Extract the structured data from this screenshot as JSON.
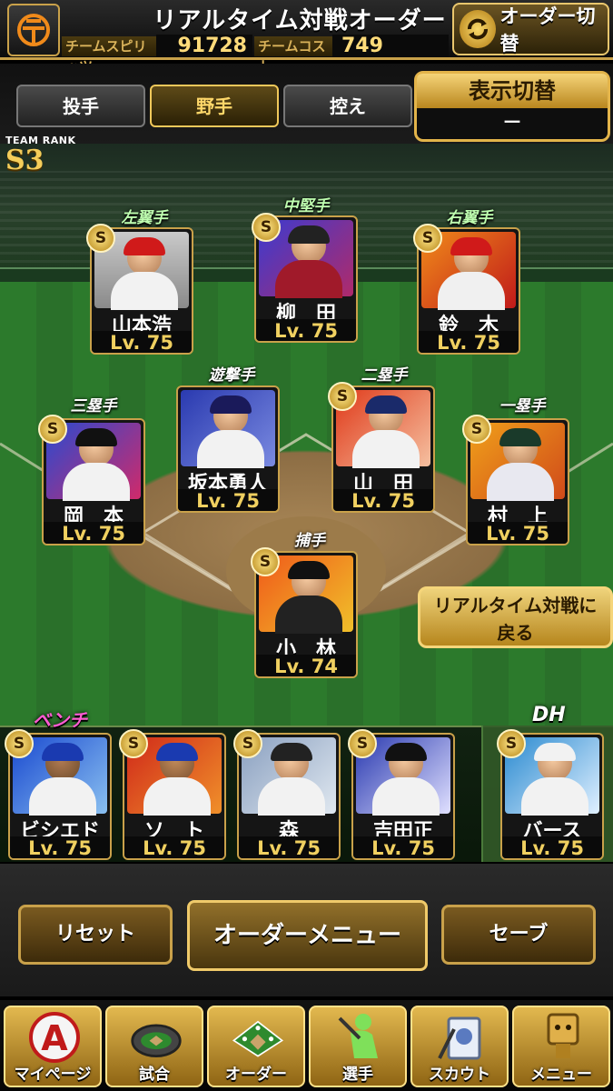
{
  "header": {
    "title": "リアルタイム対戦オーダー",
    "spirit_label": "チームスピリッツ",
    "spirit_value": "91728",
    "cost_label": "チームコスト",
    "cost_value": "749",
    "order_switch_label": "オーダー切替"
  },
  "tabs": [
    {
      "label": "投手",
      "active": false
    },
    {
      "label": "野手",
      "active": true
    },
    {
      "label": "控え",
      "active": false
    }
  ],
  "display_switch": {
    "label": "表示切替",
    "value": "－"
  },
  "team_rank": {
    "label": "TEAM RANK",
    "value": "S3"
  },
  "positions": {
    "lf": "左翼手",
    "cf": "中堅手",
    "rf": "右翼手",
    "ss": "遊撃手",
    "second": "二塁手",
    "third": "三塁手",
    "first": "一塁手",
    "catcher": "捕手",
    "bench": "ベンチ",
    "dh": "DH"
  },
  "players": {
    "lf": {
      "name": "山本浩",
      "level": "Lv. 75"
    },
    "cf": {
      "name": "柳　田",
      "level": "Lv. 75"
    },
    "rf": {
      "name": "鈴　木",
      "level": "Lv. 75"
    },
    "ss": {
      "name": "坂本勇人",
      "level": "Lv. 75"
    },
    "second": {
      "name": "山　田",
      "level": "Lv. 75"
    },
    "third": {
      "name": "岡　本",
      "level": "Lv. 75"
    },
    "first": {
      "name": "村　上",
      "level": "Lv. 75"
    },
    "catcher": {
      "name": "小　林",
      "level": "Lv. 74"
    }
  },
  "bench": [
    {
      "name": "ビシエド",
      "level": "Lv. 75"
    },
    {
      "name": "ソ　ト",
      "level": "Lv. 75"
    },
    {
      "name": "森",
      "level": "Lv. 75"
    },
    {
      "name": "吉田正",
      "level": "Lv. 75"
    }
  ],
  "dh_player": {
    "name": "バース",
    "level": "Lv. 75"
  },
  "badge_letter": "S",
  "back_button": {
    "line1": "リアルタイム対戦に",
    "line2": "戻る"
  },
  "actions": {
    "reset": "リセット",
    "order_menu": "オーダーメニュー",
    "save": "セーブ"
  },
  "nav": [
    {
      "label": "マイページ",
      "icon": "A"
    },
    {
      "label": "試合",
      "icon": "stadium"
    },
    {
      "label": "オーダー",
      "icon": "field"
    },
    {
      "label": "選手",
      "icon": "batter"
    },
    {
      "label": "スカウト",
      "icon": "scout"
    },
    {
      "label": "メニュー",
      "icon": "box-character"
    }
  ],
  "colors": {
    "accent": "#c9a14a",
    "gold_button": "#e2b84f",
    "level": "#f0d060",
    "bench_label": "#ff5bd2"
  }
}
